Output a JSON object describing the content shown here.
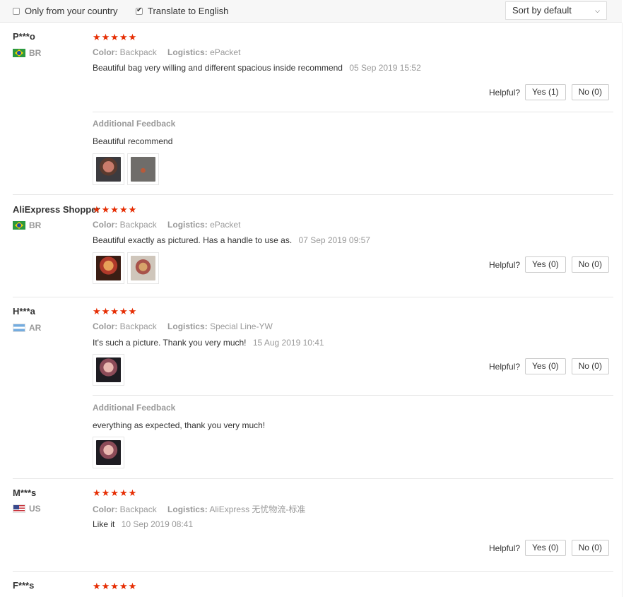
{
  "filters": {
    "only_country_label": "Only from your country",
    "only_country_checked": false,
    "translate_label": "Translate to English",
    "translate_checked": true,
    "sort_value": "Sort by default"
  },
  "labels": {
    "color": "Color:",
    "logistics": "Logistics:",
    "helpful": "Helpful?",
    "additional_feedback": "Additional Feedback"
  },
  "rating_color": "#e62e04",
  "reviews": [
    {
      "user": "P***o",
      "country": "BR",
      "flag": "brazil-flag",
      "stars": "★★★★★",
      "rating": 5,
      "color": "Backpack",
      "logistics": "ePacket",
      "text": "Beautiful bag very willing and different spacious inside recommend",
      "date": "05 Sep 2019 15:52",
      "yes": "Yes (1)",
      "no": "No (0)",
      "additional_text": "Beautiful recommend",
      "additional_images": [
        "doll-photo",
        "bag-photo"
      ]
    },
    {
      "user": "AliExpress Shopper",
      "country": "BR",
      "flag": "brazil-flag",
      "stars": "★★★★★",
      "rating": 5,
      "color": "Backpack",
      "logistics": "ePacket",
      "text": "Beautiful exactly as pictured. Has a handle to use as.",
      "date": "07 Sep 2019 09:57",
      "yes": "Yes (0)",
      "no": "No (0)",
      "images": [
        "doll-photo",
        "doll-photo"
      ]
    },
    {
      "user": "H***a",
      "country": "AR",
      "flag": "argentina-flag",
      "stars": "★★★★★",
      "rating": 5,
      "color": "Backpack",
      "logistics": "Special Line-YW",
      "text": "It's such a picture. Thank you very much!",
      "date": "15 Aug 2019 10:41",
      "yes": "Yes (0)",
      "no": "No (0)",
      "images": [
        "doll-photo"
      ],
      "additional_text": "everything as expected, thank you very much!",
      "additional_images": [
        "doll-photo"
      ]
    },
    {
      "user": "M***s",
      "country": "US",
      "flag": "us-flag",
      "stars": "★★★★★",
      "rating": 5,
      "color": "Backpack",
      "logistics": "AliExpress 无忧物流-标准",
      "text": "Like it",
      "date": "10 Sep 2019 08:41",
      "yes": "Yes (0)",
      "no": "No (0)"
    },
    {
      "user": "F***s",
      "stars": "★★★★★",
      "rating": 5
    }
  ]
}
